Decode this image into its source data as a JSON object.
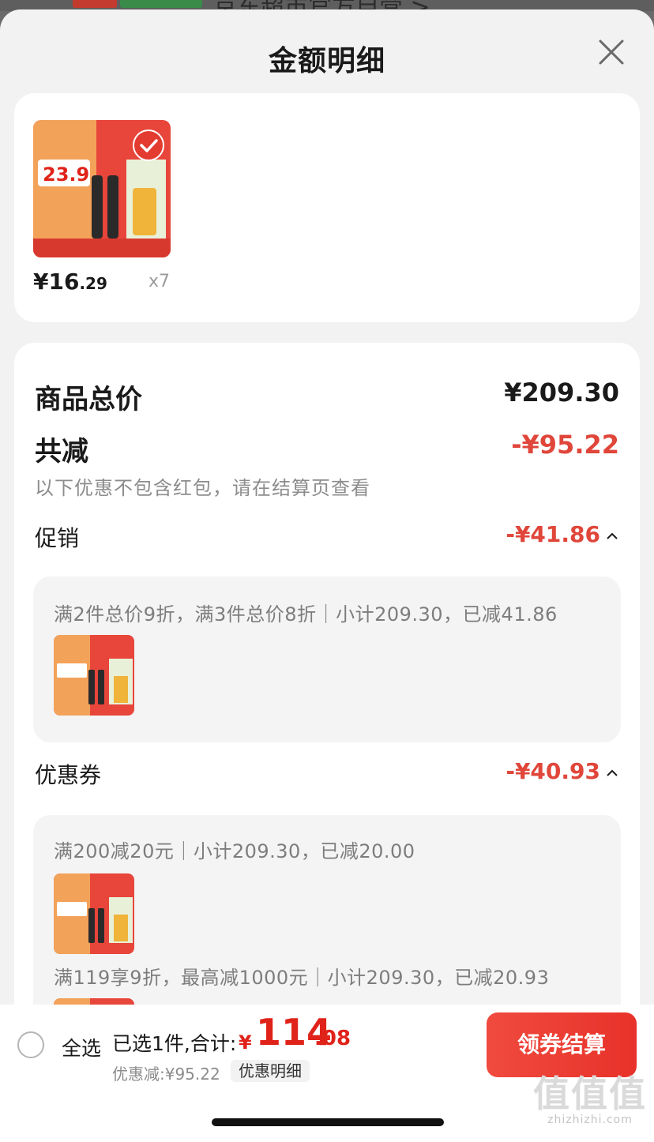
{
  "background_peek": {
    "text": "京东超市官方自营 >",
    "colors": {
      "red_badge": "#c33a2e",
      "green_badge": "#3a8a4a"
    }
  },
  "sheet": {
    "title": "金额明细",
    "close_icon": "close-icon"
  },
  "product": {
    "thumb_price": "23.9",
    "price_currency": "¥",
    "price_int": "16",
    "price_frac": ".29",
    "quantity": "x7"
  },
  "summary": {
    "total_label": "商品总价",
    "total_value": "¥209.30",
    "reduction_label": "共减",
    "reduction_value": "-¥95.22",
    "note": "以下优惠不包含红包，请在结算页查看"
  },
  "promotion": {
    "label": "促销",
    "value": "-¥41.86",
    "rules": [
      "满2件总价9折，满3件总价8折｜小计209.30，已减41.86"
    ]
  },
  "coupon": {
    "label": "优惠券",
    "value": "-¥40.93",
    "rules": [
      "满200减20元｜小计209.30，已减20.00",
      "满119享9折，最高减1000元｜小计209.30，已减20.93"
    ]
  },
  "bottom_bar": {
    "select_all": "全选",
    "selected_info": "已选1件,合计:",
    "currency": "¥",
    "total_int": "114",
    "total_frac": ".08",
    "discount_line": "优惠减:¥95.22",
    "detail_link": "优惠明细",
    "checkout": "领券结算"
  },
  "watermark": {
    "logo": "值值值",
    "url": "zhizhizhi.com"
  },
  "colors": {
    "accent_red": "#e0463a",
    "price_red": "#e0231a",
    "button_red": "#e8322a",
    "text_gray": "#8c8c8c"
  }
}
